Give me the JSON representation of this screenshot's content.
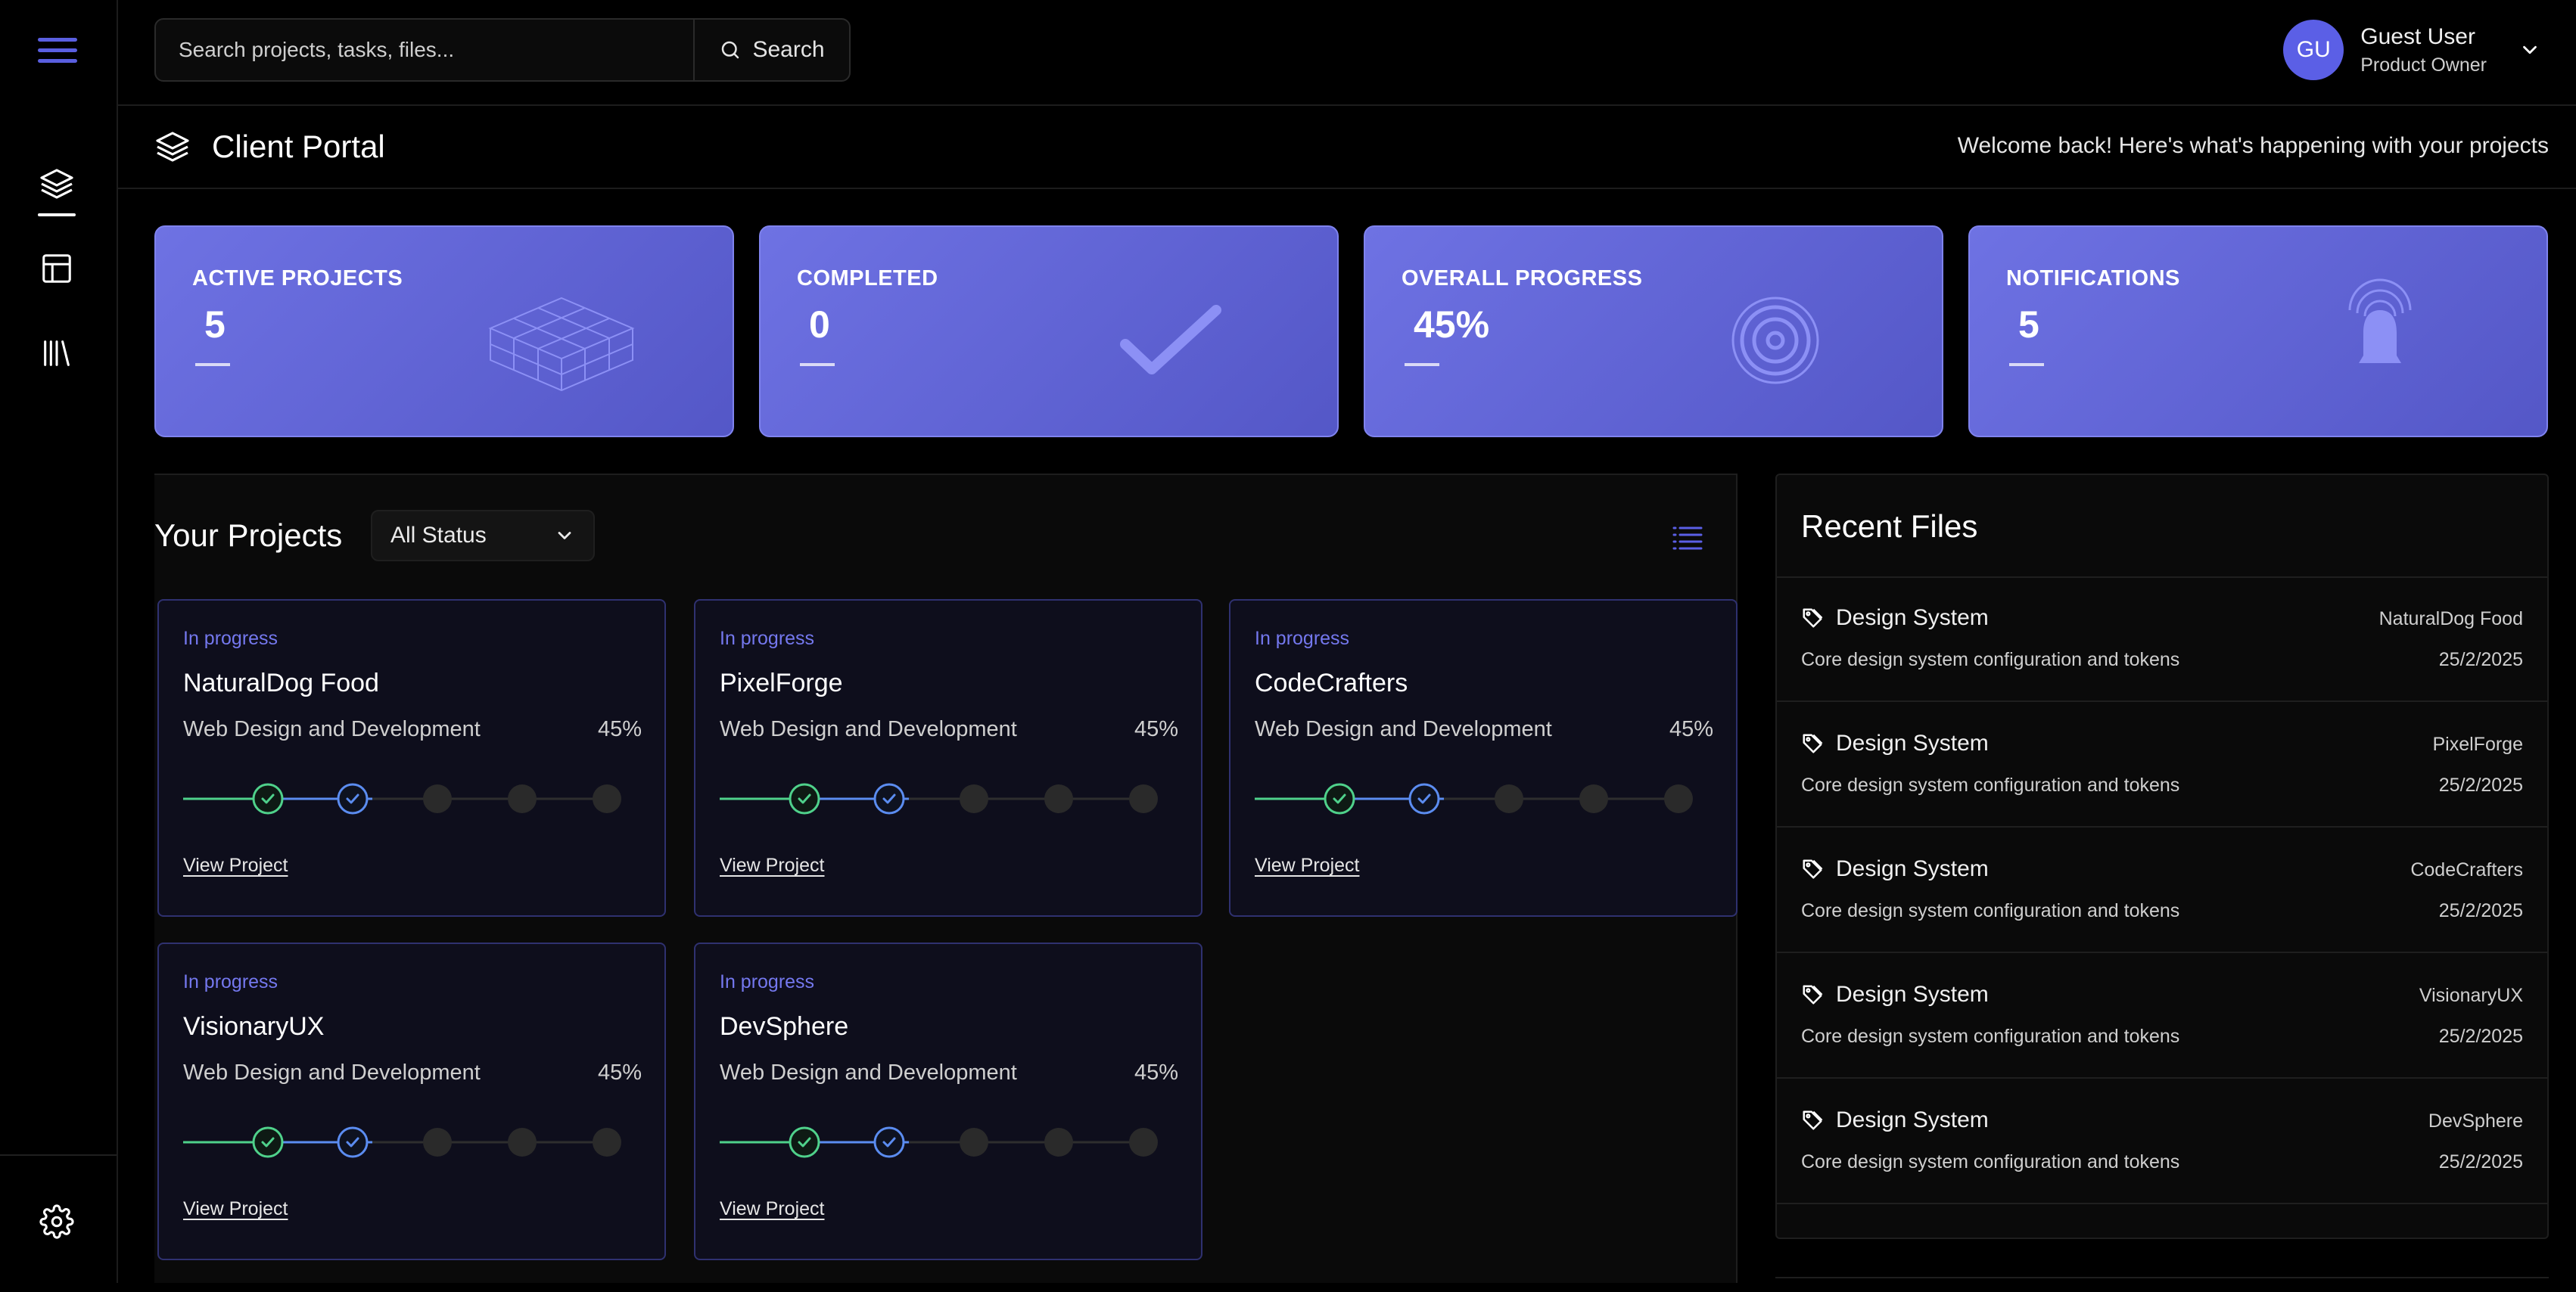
{
  "topbar": {
    "search_placeholder": "Search projects, tasks, files...",
    "search_button": "Search",
    "user": {
      "initials": "GU",
      "name": "Guest User",
      "role": "Product Owner"
    }
  },
  "header": {
    "title": "Client Portal",
    "welcome": "Welcome back! Here's what's happening with your projects"
  },
  "stats": [
    {
      "label": "ACTIVE PROJECTS",
      "value": "5",
      "icon": "cube-grid-icon"
    },
    {
      "label": "COMPLETED",
      "value": "0",
      "icon": "checkmark-icon"
    },
    {
      "label": "OVERALL PROGRESS",
      "value": "45%",
      "icon": "target-icon"
    },
    {
      "label": "NOTIFICATIONS",
      "value": "5",
      "icon": "bell-icon"
    }
  ],
  "projects_section": {
    "title": "Your Projects",
    "filter": "All Status"
  },
  "projects": [
    {
      "status": "In progress",
      "name": "NaturalDog Food",
      "type": "Web Design and Development",
      "progress": "45%",
      "link": "View Project"
    },
    {
      "status": "In progress",
      "name": "PixelForge",
      "type": "Web Design and Development",
      "progress": "45%",
      "link": "View Project"
    },
    {
      "status": "In progress",
      "name": "CodeCrafters",
      "type": "Web Design and Development",
      "progress": "45%",
      "link": "View Project"
    },
    {
      "status": "In progress",
      "name": "VisionaryUX",
      "type": "Web Design and Development",
      "progress": "45%",
      "link": "View Project"
    },
    {
      "status": "In progress",
      "name": "DevSphere",
      "type": "Web Design and Development",
      "progress": "45%",
      "link": "View Project"
    }
  ],
  "recent_files": {
    "title": "Recent Files",
    "items": [
      {
        "name": "Design System",
        "description": "Core design system configuration and tokens",
        "project": "NaturalDog Food",
        "date": "25/2/2025"
      },
      {
        "name": "Design System",
        "description": "Core design system configuration and tokens",
        "project": "PixelForge",
        "date": "25/2/2025"
      },
      {
        "name": "Design System",
        "description": "Core design system configuration and tokens",
        "project": "CodeCrafters",
        "date": "25/2/2025"
      },
      {
        "name": "Design System",
        "description": "Core design system configuration and tokens",
        "project": "VisionaryUX",
        "date": "25/2/2025"
      },
      {
        "name": "Design System",
        "description": "Core design system configuration and tokens",
        "project": "DevSphere",
        "date": "25/2/2025"
      }
    ]
  },
  "colors": {
    "accent": "#5b5fe6",
    "step_done": "#4fd18b",
    "step_current": "#5b8cf0",
    "step_pending": "#2a2a2a"
  }
}
